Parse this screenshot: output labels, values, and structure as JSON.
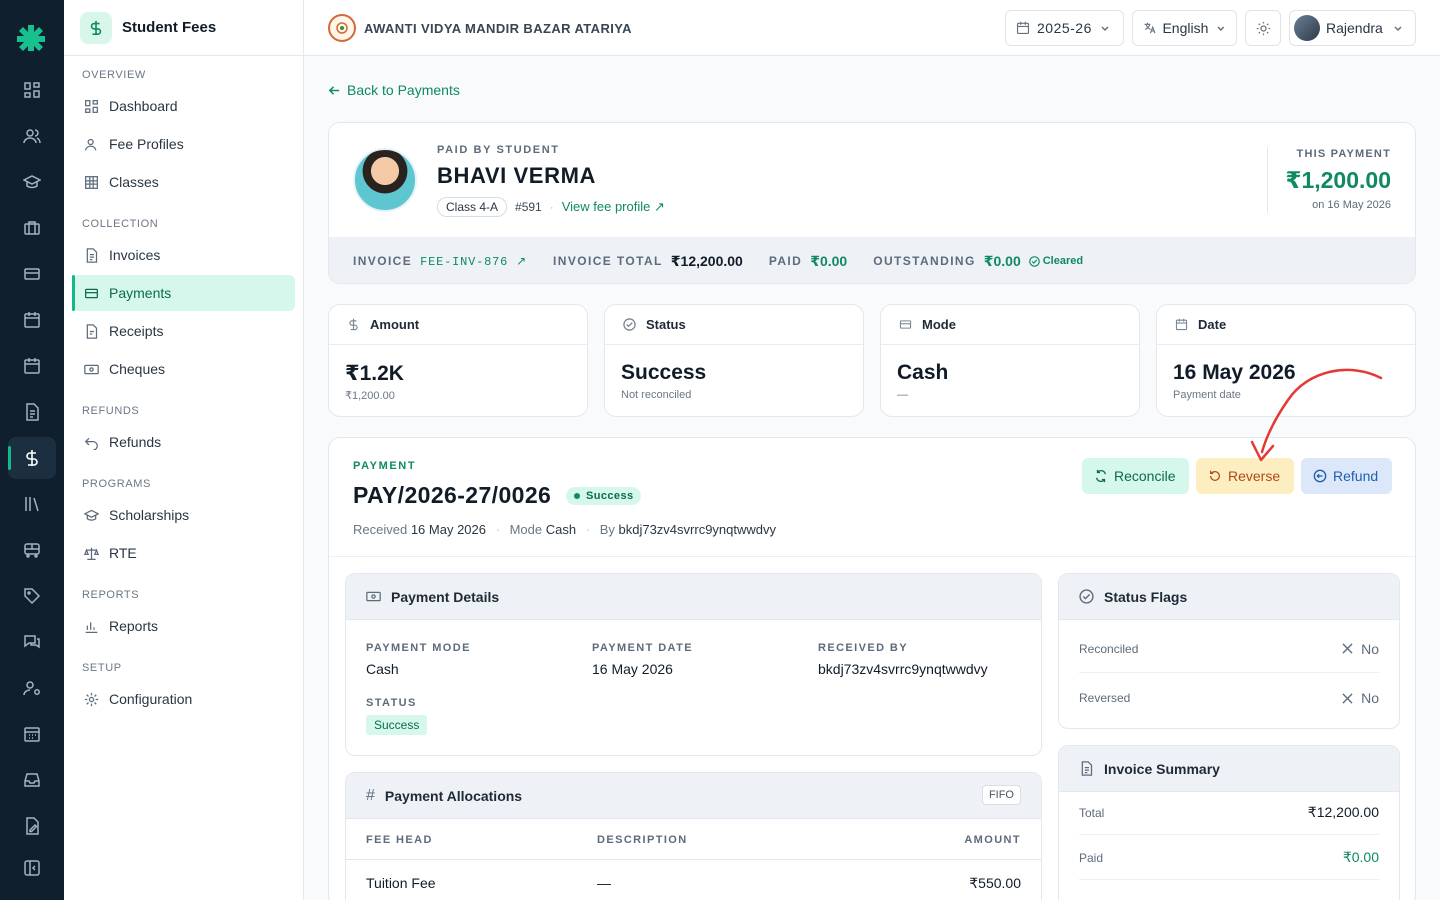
{
  "app": {
    "module_title": "Student Fees"
  },
  "rail": {
    "icons": [
      "grid-icon",
      "users-icon",
      "graduation-cap-icon",
      "briefcase-icon",
      "card-icon",
      "calendar-icon",
      "calendar-alt-icon",
      "document-icon",
      "dollar-icon",
      "library-icon",
      "bus-icon",
      "tag-icon",
      "chat-icon",
      "user-cog-icon",
      "calendar-grid-icon",
      "inbox-icon",
      "file-edit-icon",
      "collapse-icon"
    ]
  },
  "sidebar": {
    "sections": {
      "overview": "OVERVIEW",
      "collection": "COLLECTION",
      "refunds": "REFUNDS",
      "programs": "PROGRAMS",
      "reports": "REPORTS",
      "setup": "SETUP"
    },
    "items": {
      "dashboard": "Dashboard",
      "fee_profiles": "Fee Profiles",
      "classes": "Classes",
      "invoices": "Invoices",
      "payments": "Payments",
      "receipts": "Receipts",
      "cheques": "Cheques",
      "refunds": "Refunds",
      "scholarships": "Scholarships",
      "rte": "RTE",
      "reports": "Reports",
      "configuration": "Configuration"
    },
    "active": "payments"
  },
  "topbar": {
    "school_name": "AWANTI VIDYA MANDIR BAZAR ATARIYA",
    "session": "2025-26",
    "language": "English",
    "user": "Rajendra"
  },
  "page": {
    "back_label": "Back to Payments",
    "student": {
      "eyebrow": "PAID BY STUDENT",
      "name": "BHAVI VERMA",
      "class": "Class 4-A",
      "roll": "#591",
      "profile_link": "View fee profile ↗"
    },
    "this_payment": {
      "label": "THIS PAYMENT",
      "amount": "₹1,200.00",
      "date": "on 16 May 2026"
    },
    "strip": {
      "invoice_label": "INVOICE",
      "invoice_value": "FEE-INV-876 ↗",
      "total_label": "INVOICE TOTAL",
      "total_value": "₹12,200.00",
      "paid_label": "PAID",
      "paid_value": "₹0.00",
      "outstanding_label": "OUTSTANDING",
      "outstanding_value": "₹0.00",
      "cleared": "Cleared"
    },
    "stats": [
      {
        "label": "Amount",
        "value": "₹1.2K",
        "sub": "₹1,200.00"
      },
      {
        "label": "Status",
        "value": "Success",
        "sub": "Not reconciled"
      },
      {
        "label": "Mode",
        "value": "Cash",
        "sub": "—"
      },
      {
        "label": "Date",
        "value": "16 May 2026",
        "sub": "Payment date"
      }
    ],
    "payment": {
      "eyebrow": "PAYMENT",
      "id": "PAY/2026-27/0026",
      "status": "Success",
      "meta_received_label": "Received",
      "meta_received": "16 May 2026",
      "meta_mode_label": "Mode",
      "meta_mode": "Cash",
      "meta_by_label": "By",
      "meta_by": "bkdj73zv4svrrc9ynqtwwdvy",
      "actions": {
        "reconcile": "Reconcile",
        "reverse": "Reverse",
        "refund": "Refund"
      }
    },
    "details": {
      "title": "Payment Details",
      "mode_label": "PAYMENT MODE",
      "mode": "Cash",
      "date_label": "PAYMENT DATE",
      "date": "16 May 2026",
      "received_by_label": "RECEIVED BY",
      "received_by": "bkdj73zv4svrrc9ynqtwwdvy",
      "status_label": "STATUS",
      "status": "Success"
    },
    "allocations": {
      "title": "Payment Allocations",
      "tag": "FIFO",
      "columns": [
        "FEE HEAD",
        "DESCRIPTION",
        "AMOUNT"
      ],
      "rows": [
        {
          "head": "Tuition Fee",
          "description": "—",
          "amount": "₹550.00"
        }
      ]
    },
    "flags": {
      "title": "Status Flags",
      "reconciled_label": "Reconciled",
      "reconciled": "No",
      "reversed_label": "Reversed",
      "reversed": "No"
    },
    "invoice_summary": {
      "title": "Invoice Summary",
      "total_label": "Total",
      "total": "₹12,200.00",
      "paid_label": "Paid",
      "paid": "₹0.00"
    }
  },
  "colors": {
    "accent": "#0f8a62",
    "rail_bg": "#0f1f2e",
    "reverse_bg": "#fdeec2",
    "reconcile_bg": "#d6f7ec",
    "refund_bg": "#dce8f9",
    "annotation": "#e53935"
  }
}
